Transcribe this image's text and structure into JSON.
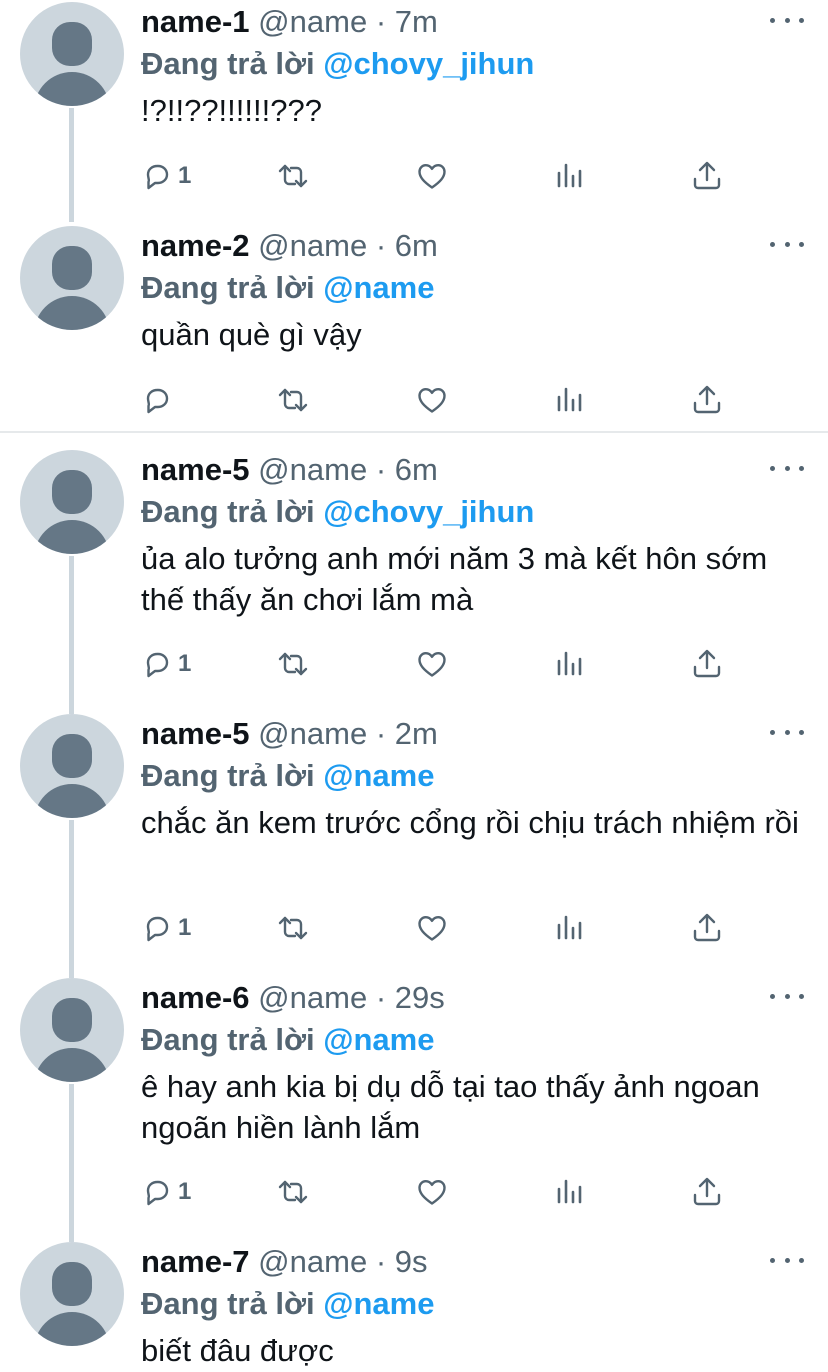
{
  "reply_prefix": "Đang trả lời",
  "tweets": [
    {
      "name": "name-1",
      "handle": "@name",
      "dot": "·",
      "time": "7m",
      "reply_to": "@chovy_jihun",
      "text": "!?!!??!!!!!!???",
      "reply_count": "1"
    },
    {
      "name": "name-2",
      "handle": "@name",
      "dot": "·",
      "time": "6m",
      "reply_to": "@name",
      "text": "quần què gì vậy",
      "reply_count": ""
    },
    {
      "name": "name-5",
      "handle": "@name",
      "dot": "·",
      "time": "6m",
      "reply_to": "@chovy_jihun",
      "text": "ủa alo tưởng anh mới năm 3 mà kết hôn sớm thế thấy ăn chơi lắm mà",
      "reply_count": "1"
    },
    {
      "name": "name-5",
      "handle": "@name",
      "dot": "·",
      "time": "2m",
      "reply_to": "@name",
      "text": "chắc ăn kem trước cổng rồi chịu trách nhiệm rồi",
      "reply_count": "1"
    },
    {
      "name": "name-6",
      "handle": "@name",
      "dot": "·",
      "time": "29s",
      "reply_to": "@name",
      "text": "ê hay anh kia bị dụ dỗ tại tao thấy ảnh ngoan ngoãn hiền lành lắm",
      "reply_count": "1"
    },
    {
      "name": "name-7",
      "handle": "@name",
      "dot": "·",
      "time": "9s",
      "reply_to": "@name",
      "text": "biết đâu được",
      "reply_count": ""
    }
  ],
  "colors": {
    "accent": "#1d9bf0",
    "muted": "#536471",
    "avatar_bg": "#ccd6dd",
    "avatar_fg": "#657786"
  },
  "icons": [
    "more-icon",
    "reply-icon",
    "retweet-icon",
    "like-icon",
    "analytics-icon",
    "share-icon"
  ]
}
